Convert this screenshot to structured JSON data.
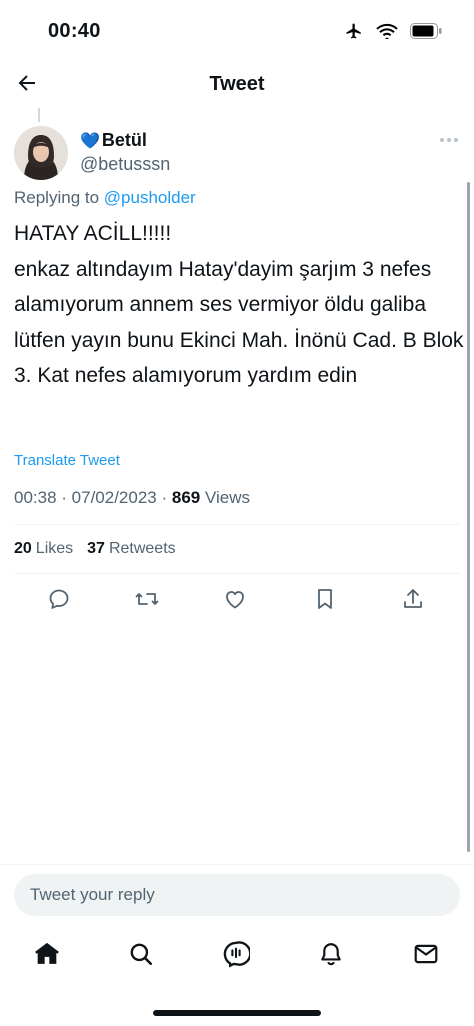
{
  "status_bar": {
    "time": "00:40",
    "icons": [
      "airplane-icon",
      "wifi-icon",
      "battery-icon"
    ]
  },
  "nav": {
    "title": "Tweet",
    "back_icon": "back-arrow-icon"
  },
  "tweet": {
    "author": {
      "emoji": "💙",
      "name": "Betül",
      "handle": "@betusssn"
    },
    "replying_prefix": "Replying to",
    "replying_handle": "@pusholder",
    "text": "HATAY ACİLL!!!!!\nenkaz altındayım Hatay'dayim şarjım 3 nefes alamıyorum annem ses vermiyor öldu galiba lütfen yayın bunu Ekinci Mah. İnönü Cad. B Blok 3. Kat nefes alamıyorum yardım edin",
    "translate_label": "Translate Tweet",
    "time": "00:38",
    "date": "07/02/2023",
    "views_count": "869",
    "views_label": "Views",
    "likes_count": "20",
    "likes_label": "Likes",
    "retweets_count": "37",
    "retweets_label": "Retweets"
  },
  "actions": [
    "reply-icon",
    "retweet-icon",
    "like-icon",
    "bookmark-icon",
    "share-icon"
  ],
  "reply_box": {
    "placeholder": "Tweet your reply"
  },
  "tabs": [
    "home-icon",
    "search-icon",
    "spaces-icon",
    "notifications-icon",
    "messages-icon"
  ],
  "colors": {
    "accent": "#1d9bf0",
    "text": "#0f1419",
    "secondary": "#536471",
    "divider": "#eff3f4",
    "heart": "#1d9bf0"
  }
}
